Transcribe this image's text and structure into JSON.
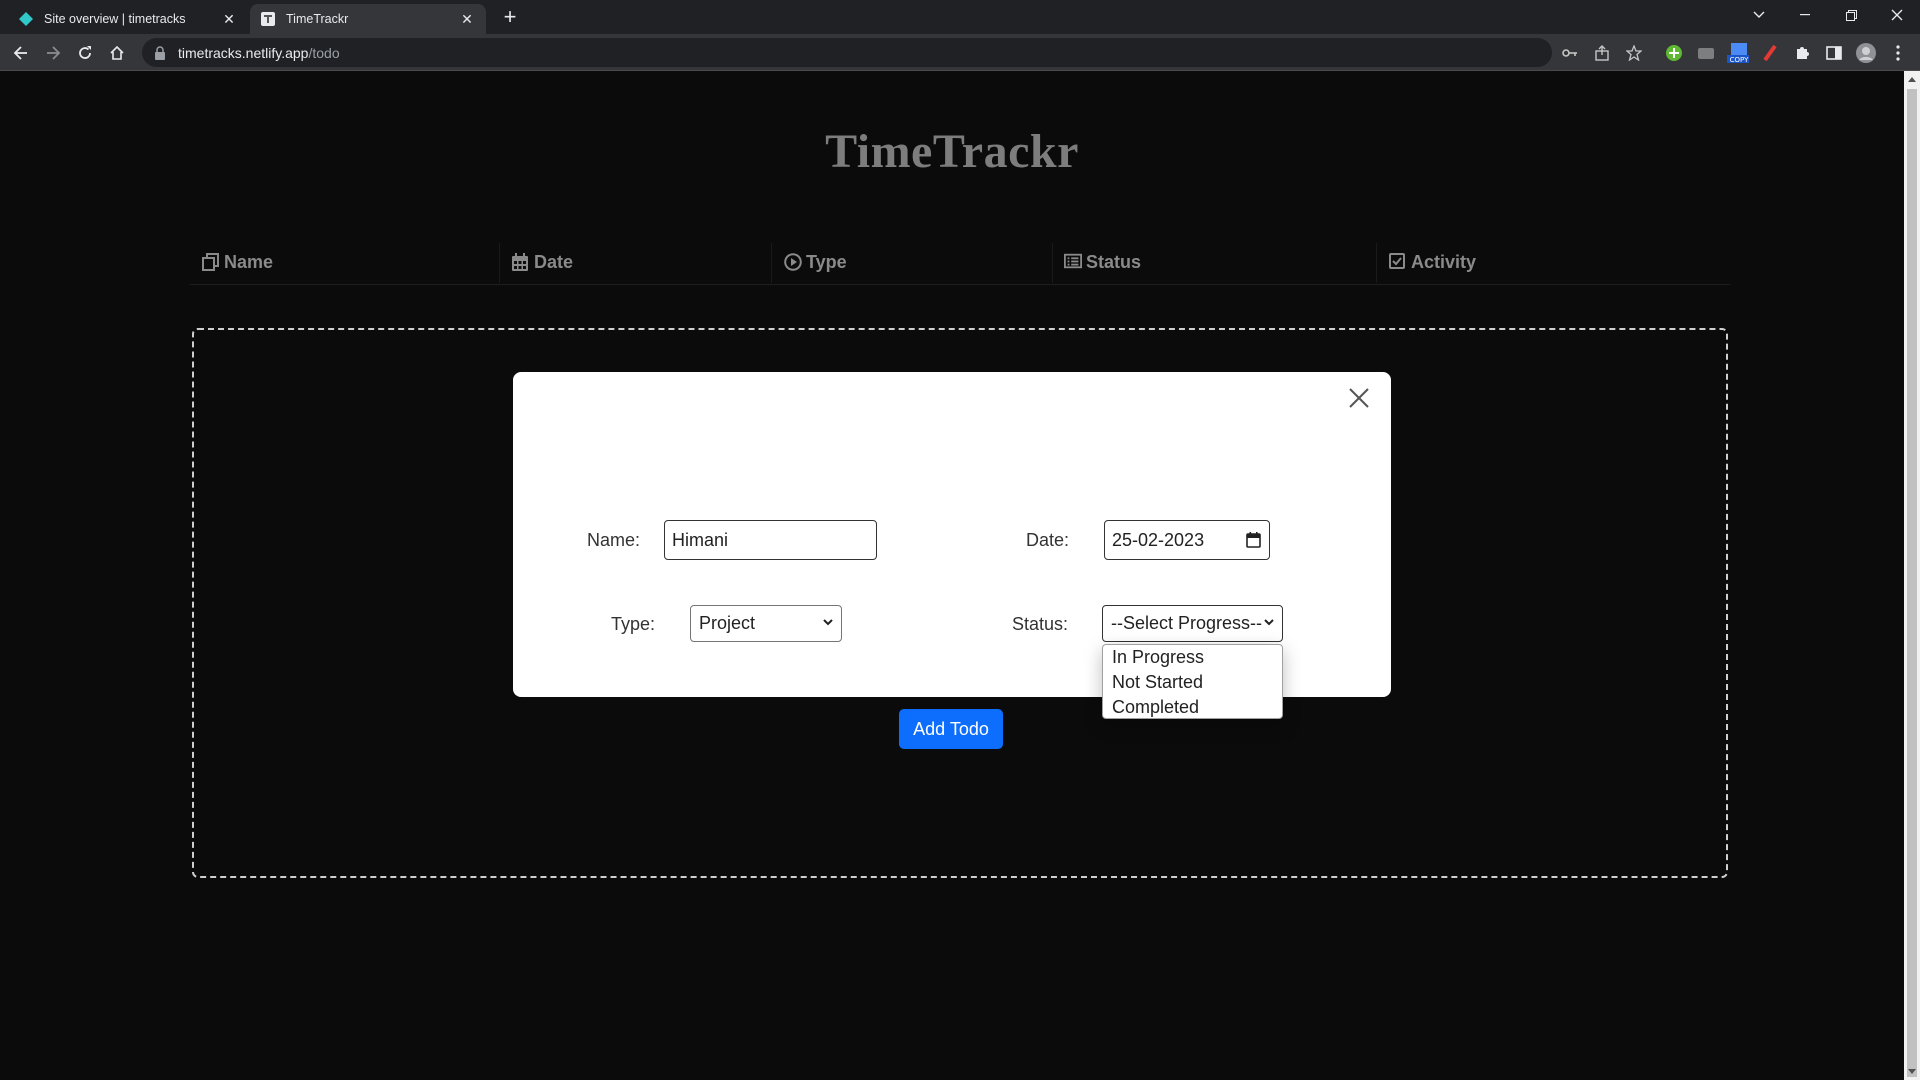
{
  "browser": {
    "tabs": [
      {
        "title": "Site overview | timetracks",
        "active": false
      },
      {
        "title": "TimeTrackr",
        "active": true
      }
    ],
    "url_host": "timetracks.netlify.app",
    "url_path": "/todo"
  },
  "app": {
    "title": "TimeTrackr",
    "columns": [
      {
        "label": "Name",
        "icon": "copy-icon"
      },
      {
        "label": "Date",
        "icon": "calendar-icon"
      },
      {
        "label": "Type",
        "icon": "play-circle-icon"
      },
      {
        "label": "Status",
        "icon": "list-icon"
      },
      {
        "label": "Activity",
        "icon": "check-square-icon"
      }
    ]
  },
  "modal": {
    "name_label": "Name:",
    "name_value": "Himani",
    "date_label": "Date:",
    "date_value": "25-02-2023",
    "type_label": "Type:",
    "type_value": "Project",
    "status_label": "Status:",
    "status_value": "--Select Progress--",
    "status_options": [
      "In Progress",
      "Not Started",
      "Completed"
    ],
    "submit_label": "Add Todo"
  },
  "colors": {
    "page_bg": "#0b0b0b",
    "accent": "#0d6efd",
    "title": "#7d7d7d"
  }
}
